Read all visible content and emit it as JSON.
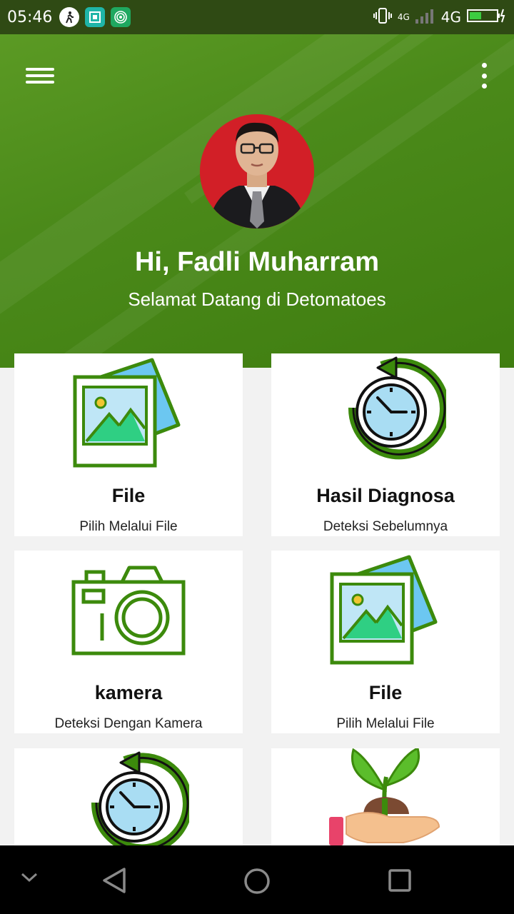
{
  "status_bar": {
    "time": "05:46",
    "network_label": "4G",
    "network_small_label": "4G"
  },
  "header": {
    "greeting": "Hi, Fadli Muharram",
    "welcome": "Selamat Datang di Detomatoes",
    "menu_icon": "hamburger-menu-icon",
    "more_icon": "more-vertical-icon"
  },
  "cards": [
    {
      "title": "File",
      "subtitle": "Pilih Melalui File",
      "icon": "gallery-icon"
    },
    {
      "title": "Hasil Diagnosa",
      "subtitle": "Deteksi Sebelumnya",
      "icon": "history-clock-icon"
    },
    {
      "title": "kamera",
      "subtitle": "Deteksi Dengan Kamera",
      "icon": "camera-icon"
    },
    {
      "title": "File",
      "subtitle": "Pilih Melalui File",
      "icon": "gallery-icon"
    },
    {
      "title": "",
      "subtitle": "",
      "icon": "history-clock-icon"
    },
    {
      "title": "",
      "subtitle": "",
      "icon": "plant-in-hand-icon"
    }
  ],
  "nav_bar": {
    "icons": [
      "chevron-down-icon",
      "back-icon",
      "home-icon",
      "recents-icon"
    ]
  },
  "colors": {
    "header_green": "#4b8a1a",
    "icon_green": "#3c8a0c",
    "status_bar": "#2f4a14"
  }
}
